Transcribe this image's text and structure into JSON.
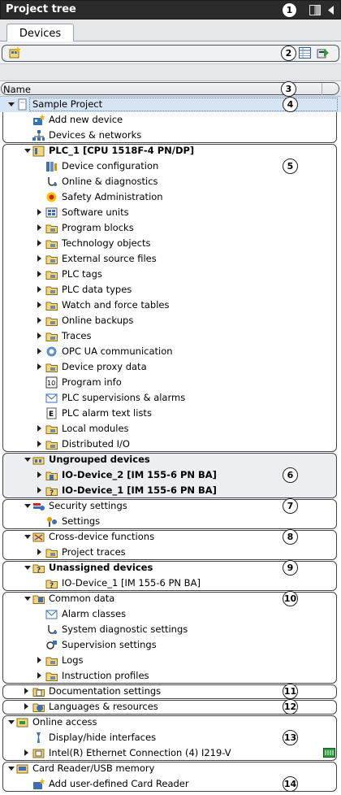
{
  "window": {
    "title": "Project tree",
    "callout": "1",
    "icons": [
      "split-view-icon",
      "collapse-left-icon"
    ]
  },
  "tabs": [
    {
      "label": "Devices"
    }
  ],
  "toolbar": {
    "callout": "2",
    "icons": [
      "add-device-icon",
      "table-view-icon",
      "go-online-icon"
    ]
  },
  "column_header": {
    "name_label": "Name",
    "callout": "3"
  },
  "callouts": {
    "project": "4",
    "plc": "5",
    "ungrouped": "6",
    "security": "7",
    "cross_device": "8",
    "unassigned": "9",
    "common_data": "10",
    "documentation": "11",
    "languages": "12",
    "online_access": "13",
    "card_reader": "14"
  },
  "tree": [
    {
      "label": "Sample Project",
      "level": 0,
      "state": "expanded",
      "icon": "project-icon",
      "selected": true
    },
    {
      "label": "Add new device",
      "level": 1,
      "state": "leaf",
      "icon": "add-device-icon"
    },
    {
      "label": "Devices & networks",
      "level": 1,
      "state": "leaf",
      "icon": "network-icon"
    },
    {
      "label": "PLC_1 [CPU 1518F-4 PN/DP]",
      "level": 1,
      "state": "expanded",
      "icon": "plc-icon",
      "bold": true
    },
    {
      "label": "Device configuration",
      "level": 2,
      "state": "leaf",
      "icon": "device-config-icon"
    },
    {
      "label": "Online & diagnostics",
      "level": 2,
      "state": "leaf",
      "icon": "diagnostics-icon"
    },
    {
      "label": "Safety Administration",
      "level": 2,
      "state": "leaf",
      "icon": "safety-icon"
    },
    {
      "label": "Software units",
      "level": 2,
      "state": "collapsed",
      "icon": "software-units-icon"
    },
    {
      "label": "Program blocks",
      "level": 2,
      "state": "collapsed",
      "icon": "folder-icon"
    },
    {
      "label": "Technology objects",
      "level": 2,
      "state": "collapsed",
      "icon": "folder-icon"
    },
    {
      "label": "External source files",
      "level": 2,
      "state": "collapsed",
      "icon": "folder-icon"
    },
    {
      "label": "PLC tags",
      "level": 2,
      "state": "collapsed",
      "icon": "folder-icon"
    },
    {
      "label": "PLC data types",
      "level": 2,
      "state": "collapsed",
      "icon": "folder-icon"
    },
    {
      "label": "Watch and force tables",
      "level": 2,
      "state": "collapsed",
      "icon": "folder-icon"
    },
    {
      "label": "Online backups",
      "level": 2,
      "state": "collapsed",
      "icon": "folder-icon"
    },
    {
      "label": "Traces",
      "level": 2,
      "state": "collapsed",
      "icon": "folder-icon"
    },
    {
      "label": "OPC UA communication",
      "level": 2,
      "state": "collapsed",
      "icon": "opc-ua-icon"
    },
    {
      "label": "Device proxy data",
      "level": 2,
      "state": "collapsed",
      "icon": "folder-icon"
    },
    {
      "label": "Program info",
      "level": 2,
      "state": "leaf",
      "icon": "program-info-icon"
    },
    {
      "label": "PLC supervisions & alarms",
      "level": 2,
      "state": "leaf",
      "icon": "alarm-icon"
    },
    {
      "label": "PLC alarm text lists",
      "level": 2,
      "state": "leaf",
      "icon": "text-list-icon"
    },
    {
      "label": "Local modules",
      "level": 2,
      "state": "collapsed",
      "icon": "folder-icon"
    },
    {
      "label": "Distributed I/O",
      "level": 2,
      "state": "collapsed",
      "icon": "folder-icon"
    },
    {
      "label": "Ungrouped devices",
      "level": 1,
      "state": "expanded",
      "icon": "ungrouped-icon",
      "bold": true
    },
    {
      "label": "IO-Device_2 [IM 155-6 PN BA]",
      "level": 2,
      "state": "collapsed",
      "icon": "io-device-icon",
      "bold": true
    },
    {
      "label": "IO-Device_1 [IM 155-6 PN BA]",
      "level": 2,
      "state": "collapsed",
      "icon": "io-device-unknown-icon",
      "bold": true
    },
    {
      "label": "Security settings",
      "level": 1,
      "state": "expanded",
      "icon": "security-icon"
    },
    {
      "label": "Settings",
      "level": 2,
      "state": "leaf",
      "icon": "settings-icon"
    },
    {
      "label": "Cross-device functions",
      "level": 1,
      "state": "expanded",
      "icon": "cross-device-icon"
    },
    {
      "label": "Project traces",
      "level": 2,
      "state": "collapsed",
      "icon": "folder-icon"
    },
    {
      "label": "Unassigned devices",
      "level": 1,
      "state": "expanded",
      "icon": "unassigned-icon",
      "bold": true
    },
    {
      "label": "IO-Device_1 [IM 155-6 PN BA]",
      "level": 2,
      "state": "leaf",
      "icon": "io-device-unknown-icon"
    },
    {
      "label": "Common data",
      "level": 1,
      "state": "expanded",
      "icon": "common-data-icon"
    },
    {
      "label": "Alarm classes",
      "level": 2,
      "state": "leaf",
      "icon": "alarm-icon"
    },
    {
      "label": "System diagnostic settings",
      "level": 2,
      "state": "leaf",
      "icon": "diagnostics-icon"
    },
    {
      "label": "Supervision settings",
      "level": 2,
      "state": "leaf",
      "icon": "supervision-icon"
    },
    {
      "label": "Logs",
      "level": 2,
      "state": "collapsed",
      "icon": "folder-icon"
    },
    {
      "label": "Instruction profiles",
      "level": 2,
      "state": "collapsed",
      "icon": "folder-icon"
    },
    {
      "label": "Documentation settings",
      "level": 1,
      "state": "collapsed",
      "icon": "documentation-icon"
    },
    {
      "label": "Languages & resources",
      "level": 1,
      "state": "collapsed",
      "icon": "languages-icon"
    },
    {
      "label": "Online access",
      "level": 0,
      "state": "expanded",
      "icon": "online-access-icon"
    },
    {
      "label": "Display/hide interfaces",
      "level": 1,
      "state": "leaf",
      "icon": "interface-icon"
    },
    {
      "label": "Intel(R) Ethernet Connection (4) I219-V",
      "level": 1,
      "state": "collapsed",
      "icon": "ethernet-icon"
    },
    {
      "label": "Card Reader/USB memory",
      "level": 0,
      "state": "expanded",
      "icon": "card-reader-icon"
    },
    {
      "label": "Add user-defined Card Reader",
      "level": 1,
      "state": "leaf",
      "icon": "add-card-reader-icon"
    }
  ]
}
